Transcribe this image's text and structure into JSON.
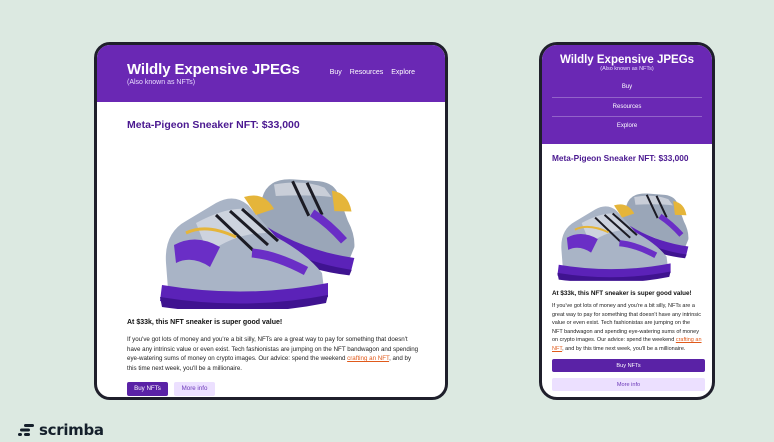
{
  "site": {
    "title": "Wildly Expensive JPEGs",
    "subtitle": "(Also known as NFTs)",
    "nav": [
      "Buy",
      "Resources",
      "Explore"
    ]
  },
  "product": {
    "heading": "Meta-Pigeon Sneaker NFT: $33,000",
    "image_icon": "sneaker-illustration",
    "tagline": "At $33k, this NFT sneaker is super good value!",
    "description_before": "If you've got lots of money and you're a bit silly, NFTs are a great way to pay for something that doesn't have any intrinsic value or even exist. Tech fashionistas are jumping on the NFT bandwagon and spending eye-watering sums of money on crypto images. Our advice: spend the weekend ",
    "description_link": "crafting an NFT",
    "description_after": ", and by this time next week, you'll be a millionaire.",
    "buy_label": "Buy NFTs",
    "more_label": "More info"
  },
  "brand": {
    "logo_text": "scrimba"
  },
  "colors": {
    "background": "#dce9e1",
    "header_purple": "#6a28b4",
    "heading_purple": "#4a1890",
    "link_orange": "#e05a1b",
    "more_button_bg": "#ece0ff"
  }
}
